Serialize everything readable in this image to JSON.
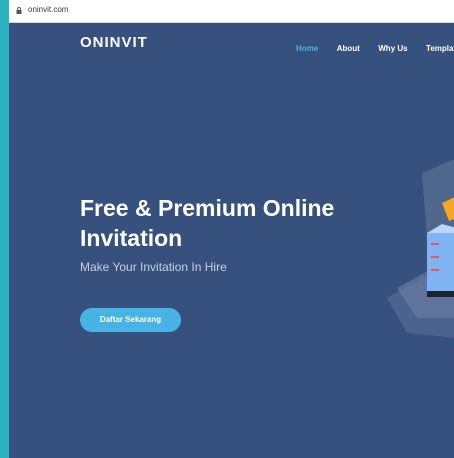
{
  "browser": {
    "url": "oninvit.com"
  },
  "header": {
    "logo": "ONINVIT",
    "nav": [
      "Home",
      "About",
      "Why Us",
      "Templat"
    ]
  },
  "hero": {
    "title_line1": "Free & Premium Online",
    "title_line2": "Invitation",
    "subtitle": "Make Your Invitation In Hire",
    "cta_label": "Daftar Sekarang"
  },
  "colors": {
    "page_bg": "#37517e",
    "accent": "#47b2e4",
    "outer_bg": "#2bb3bf"
  }
}
